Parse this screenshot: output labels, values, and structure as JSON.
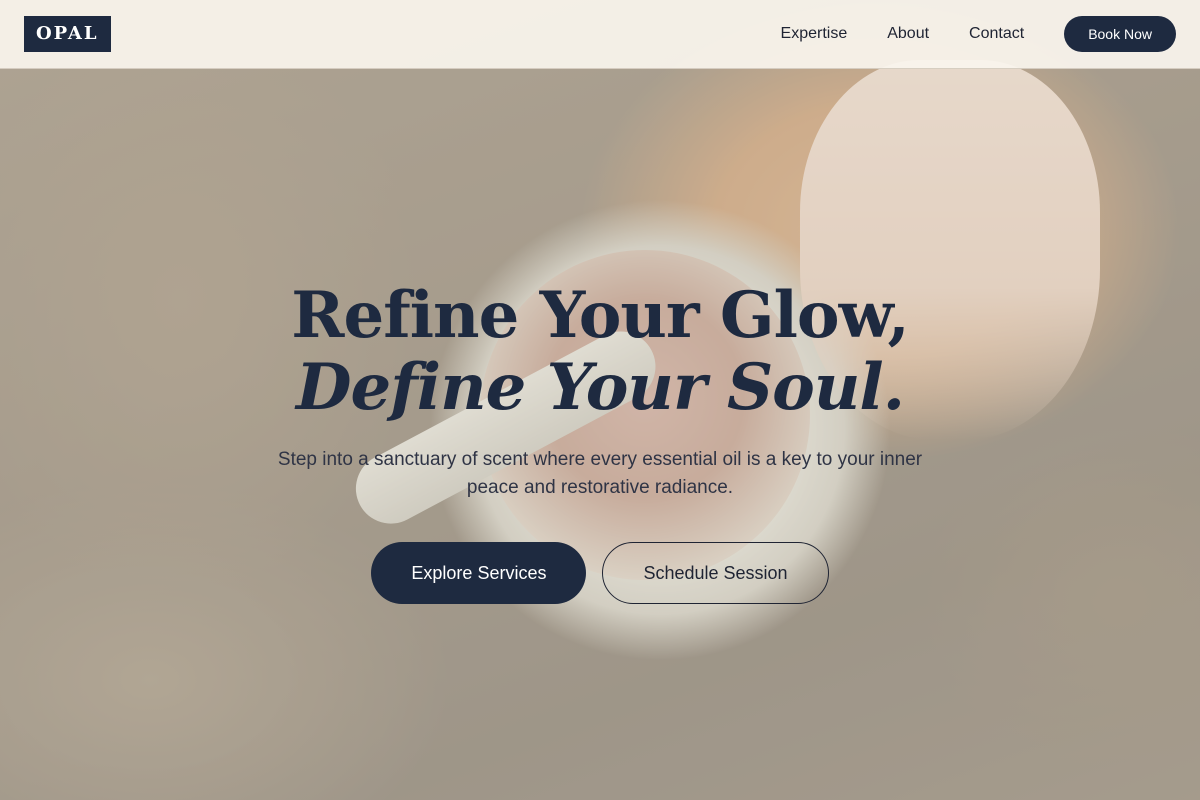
{
  "brand": {
    "logo_text": "OPAL"
  },
  "nav": {
    "items": [
      {
        "label": "Expertise"
      },
      {
        "label": "About"
      },
      {
        "label": "Contact"
      }
    ],
    "cta_label": "Book Now"
  },
  "hero": {
    "headline_line1": "Refine Your Glow,",
    "headline_line2": "Define Your Soul.",
    "subtitle": "Step into a sanctuary of scent where every essential oil is a key to your inner peace and restorative radiance.",
    "primary_cta": "Explore Services",
    "secondary_cta": "Schedule Session"
  },
  "colors": {
    "brand_navy": "#1e2a40",
    "header_bg": "#faf5ee",
    "text_dark": "#1f2433"
  }
}
